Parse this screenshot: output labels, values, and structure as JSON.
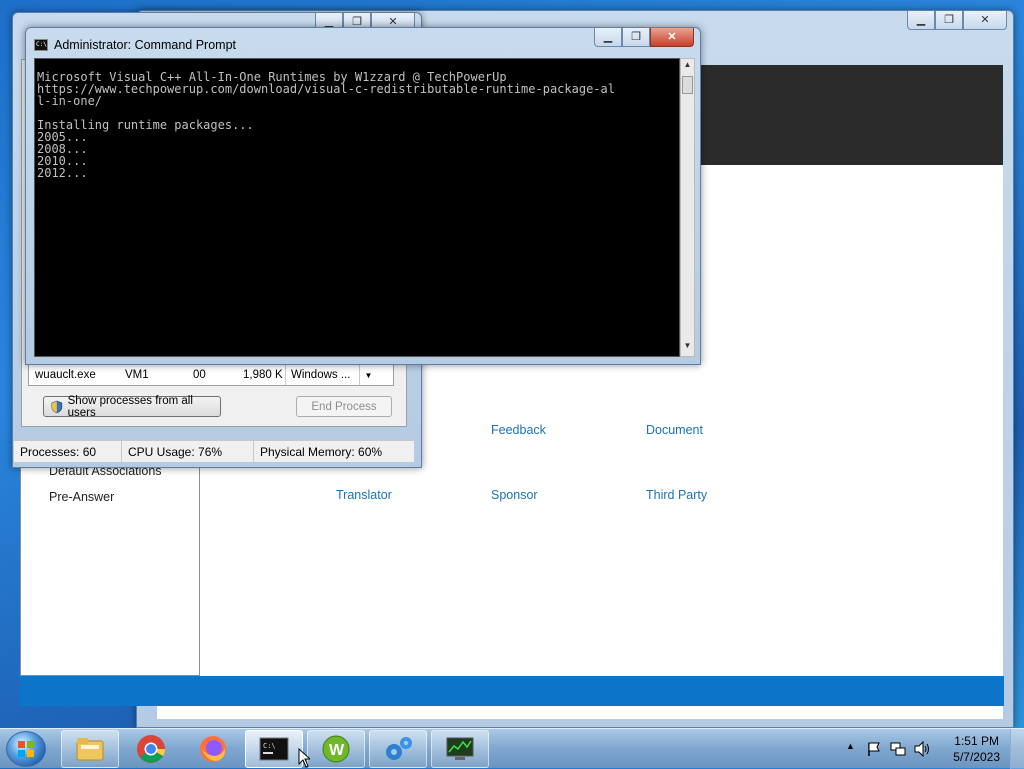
{
  "background_app": {
    "links_row1": [
      "Feedback",
      "Document"
    ],
    "links_row2": [
      "Translator",
      "Sponsor",
      "Third Party"
    ],
    "sidebar_items": [
      "Default Associations",
      "Pre-Answer"
    ]
  },
  "task_manager": {
    "visible_row": {
      "image_name": "wuauclt.exe",
      "user": "VM1",
      "cpu": "00",
      "memory": "1,980 K",
      "description": "Windows ..."
    },
    "show_all_label": "Show processes from all users",
    "end_process_label": "End Process",
    "status": {
      "processes": "Processes: 60",
      "cpu_usage": "CPU Usage: 76%",
      "physical_memory": "Physical Memory: 60%"
    }
  },
  "cmd": {
    "title": "Administrator:  Command Prompt",
    "lines": [
      "Microsoft Visual C++ All-In-One Runtimes by W1zzard @ TechPowerUp",
      "https://www.techpowerup.com/download/visual-c-redistributable-runtime-package-al",
      "l-in-one/",
      "",
      "Installing runtime packages...",
      "2005...",
      "2008...",
      "2010...",
      "2012..."
    ]
  },
  "taskbar": {
    "pinned": [
      "windows-explorer",
      "chrome",
      "firefox",
      "command-prompt",
      "w-app",
      "gears-app",
      "task-manager"
    ],
    "clock_time": "1:51 PM",
    "clock_date": "5/7/2023"
  },
  "colors": {
    "accent_blue": "#0c74c9",
    "link_blue": "#1a73b8",
    "console_bg": "#000000",
    "console_fg": "#c0c0c0"
  }
}
